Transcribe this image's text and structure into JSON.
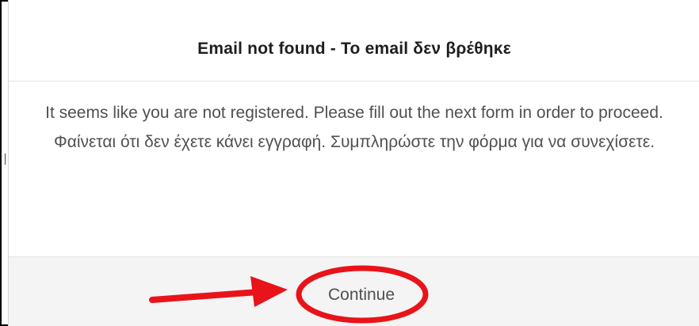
{
  "dialog": {
    "title": "Email not found - Το email δεν βρέθηκε",
    "message_en": "It seems like you are not registered. Please fill out the next form in order to proceed.",
    "message_el": "Φαίνεται ότι δεν έχετε κάνει εγγραφή. Συμπληρώστε την φόρμα για να συνεχίσετε.",
    "continue_label": "Continue"
  },
  "annotation": {
    "color": "#e8141a",
    "shapes": [
      "arrow",
      "ellipse"
    ]
  }
}
